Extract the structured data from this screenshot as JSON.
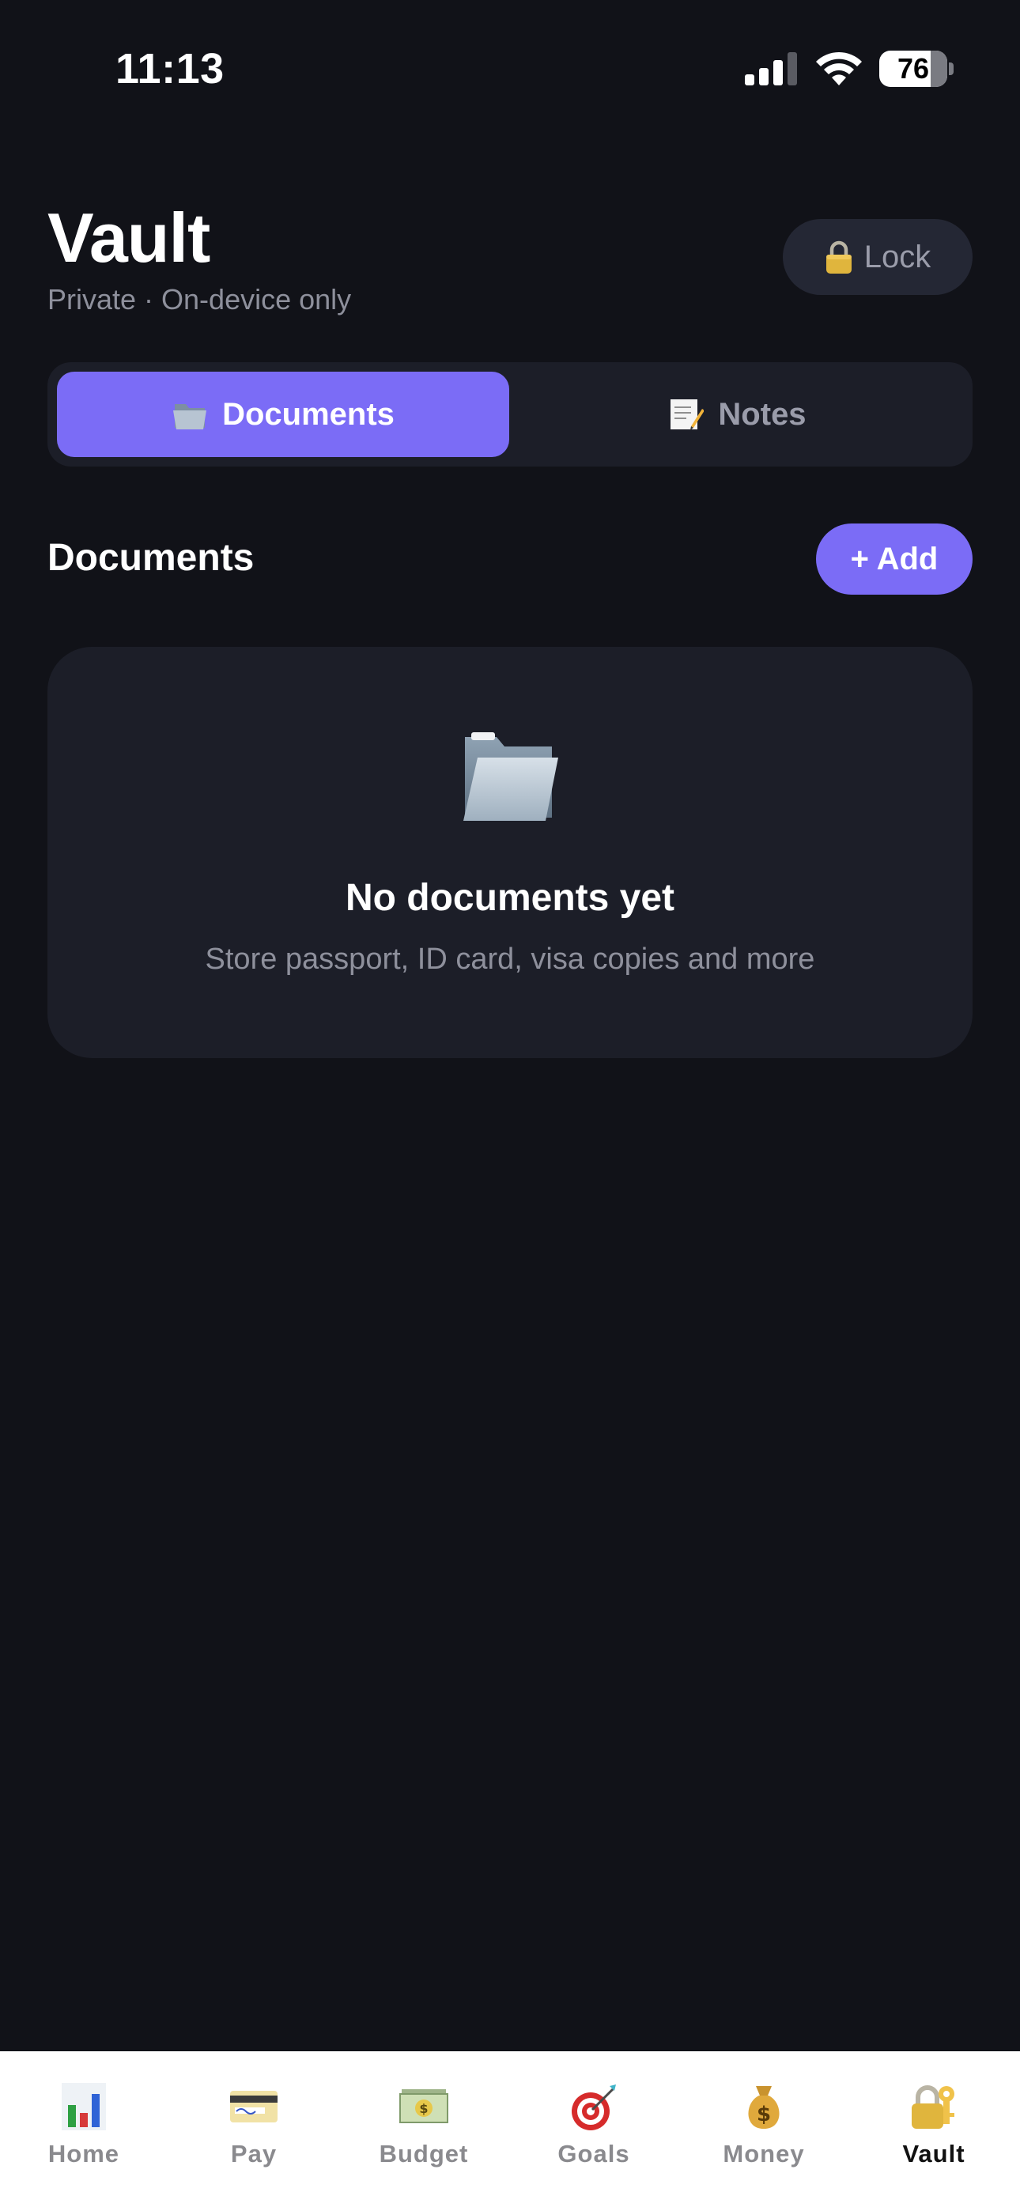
{
  "status_bar": {
    "time": "11:13",
    "battery": "76"
  },
  "header": {
    "title": "Vault",
    "subtitle": "Private · On-device only",
    "lock_label": "Lock"
  },
  "tabs_segment": [
    {
      "label": "Documents",
      "icon": "folder-icon",
      "active": true
    },
    {
      "label": "Notes",
      "icon": "memo-icon",
      "active": false
    }
  ],
  "section": {
    "title": "Documents",
    "add_label": "+ Add"
  },
  "empty_state": {
    "icon": "open-folder-icon",
    "title": "No documents yet",
    "description": "Store passport, ID card, visa copies and more"
  },
  "tab_bar": [
    {
      "label": "Home",
      "icon": "bar-chart-icon",
      "active": false
    },
    {
      "label": "Pay",
      "icon": "credit-card-icon",
      "active": false
    },
    {
      "label": "Budget",
      "icon": "dollar-banknote-icon",
      "active": false
    },
    {
      "label": "Goals",
      "icon": "target-icon",
      "active": false
    },
    {
      "label": "Money",
      "icon": "money-bag-icon",
      "active": false
    },
    {
      "label": "Vault",
      "icon": "lock-with-key-icon",
      "active": true
    }
  ],
  "colors": {
    "background": "#111218",
    "card": "#1c1e28",
    "accent": "#7b6cf6",
    "muted_text": "#8e909c"
  }
}
